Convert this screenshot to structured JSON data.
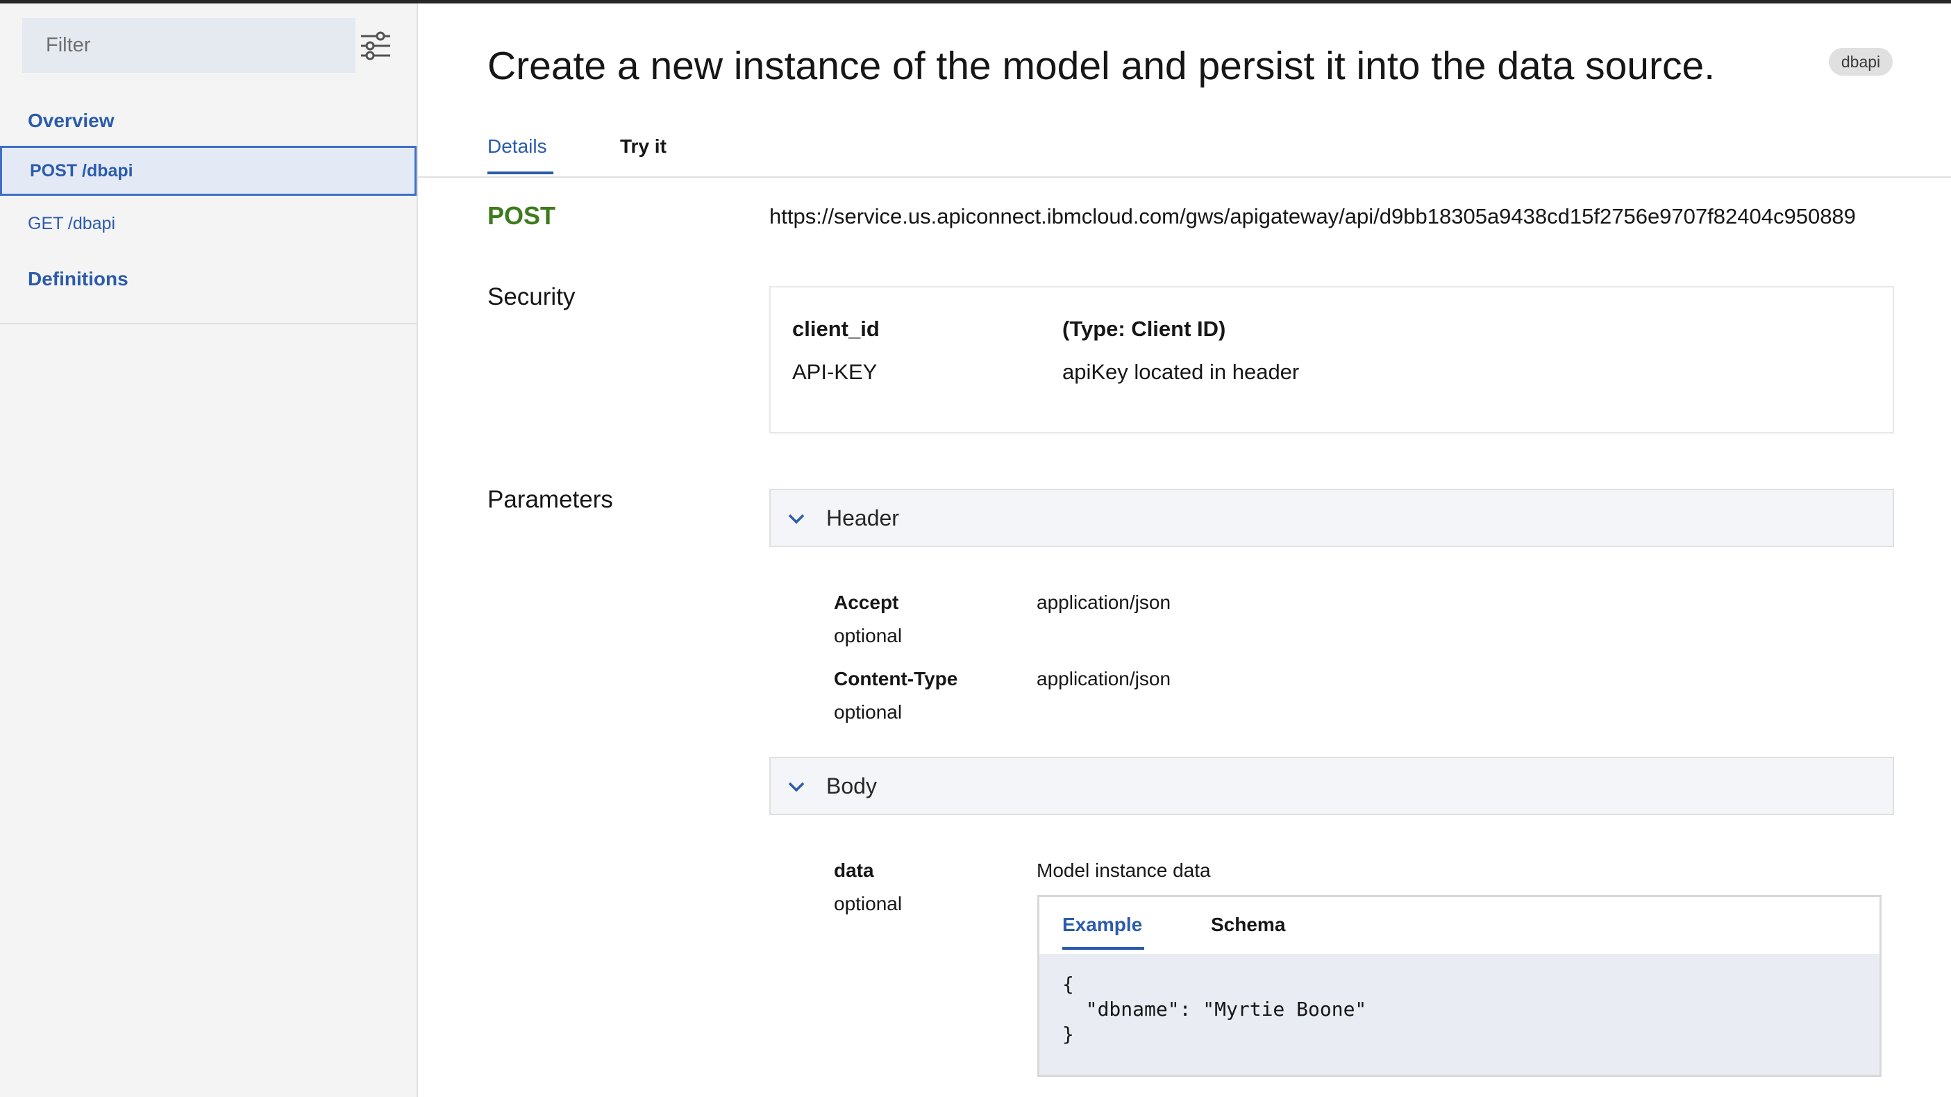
{
  "sidebar": {
    "filter_placeholder": "Filter",
    "overview_label": "Overview",
    "items": [
      {
        "label": "POST /dbapi",
        "active": true
      },
      {
        "label": "GET /dbapi",
        "active": false
      }
    ],
    "definitions_label": "Definitions"
  },
  "header": {
    "title": "Create a new instance of the model and persist it into the data source.",
    "badge": "dbapi"
  },
  "tabs": {
    "details": "Details",
    "try_it": "Try it"
  },
  "operation": {
    "method": "POST",
    "url": "https://service.us.apiconnect.ibmcloud.com/gws/apigateway/api/d9bb18305a9438cd15f2756e9707f82404c950889"
  },
  "security": {
    "label": "Security",
    "key": "client_id",
    "type": "(Type: Client ID)",
    "name": "API-KEY",
    "location": "apiKey located in header"
  },
  "parameters": {
    "label": "Parameters",
    "header_section": {
      "title": "Header",
      "params": [
        {
          "name": "Accept",
          "required": "optional",
          "value": "application/json"
        },
        {
          "name": "Content-Type",
          "required": "optional",
          "value": "application/json"
        }
      ]
    },
    "body_section": {
      "title": "Body",
      "param": {
        "name": "data",
        "required": "optional",
        "description": "Model instance data"
      },
      "example_tab": "Example",
      "schema_tab": "Schema",
      "example_code": "{\n  \"dbname\": \"Myrtie Boone\"\n}"
    }
  },
  "colors": {
    "accent": "#2b5bac",
    "method_post": "#3e7b1c",
    "sidebar_bg": "#f4f4f4"
  }
}
